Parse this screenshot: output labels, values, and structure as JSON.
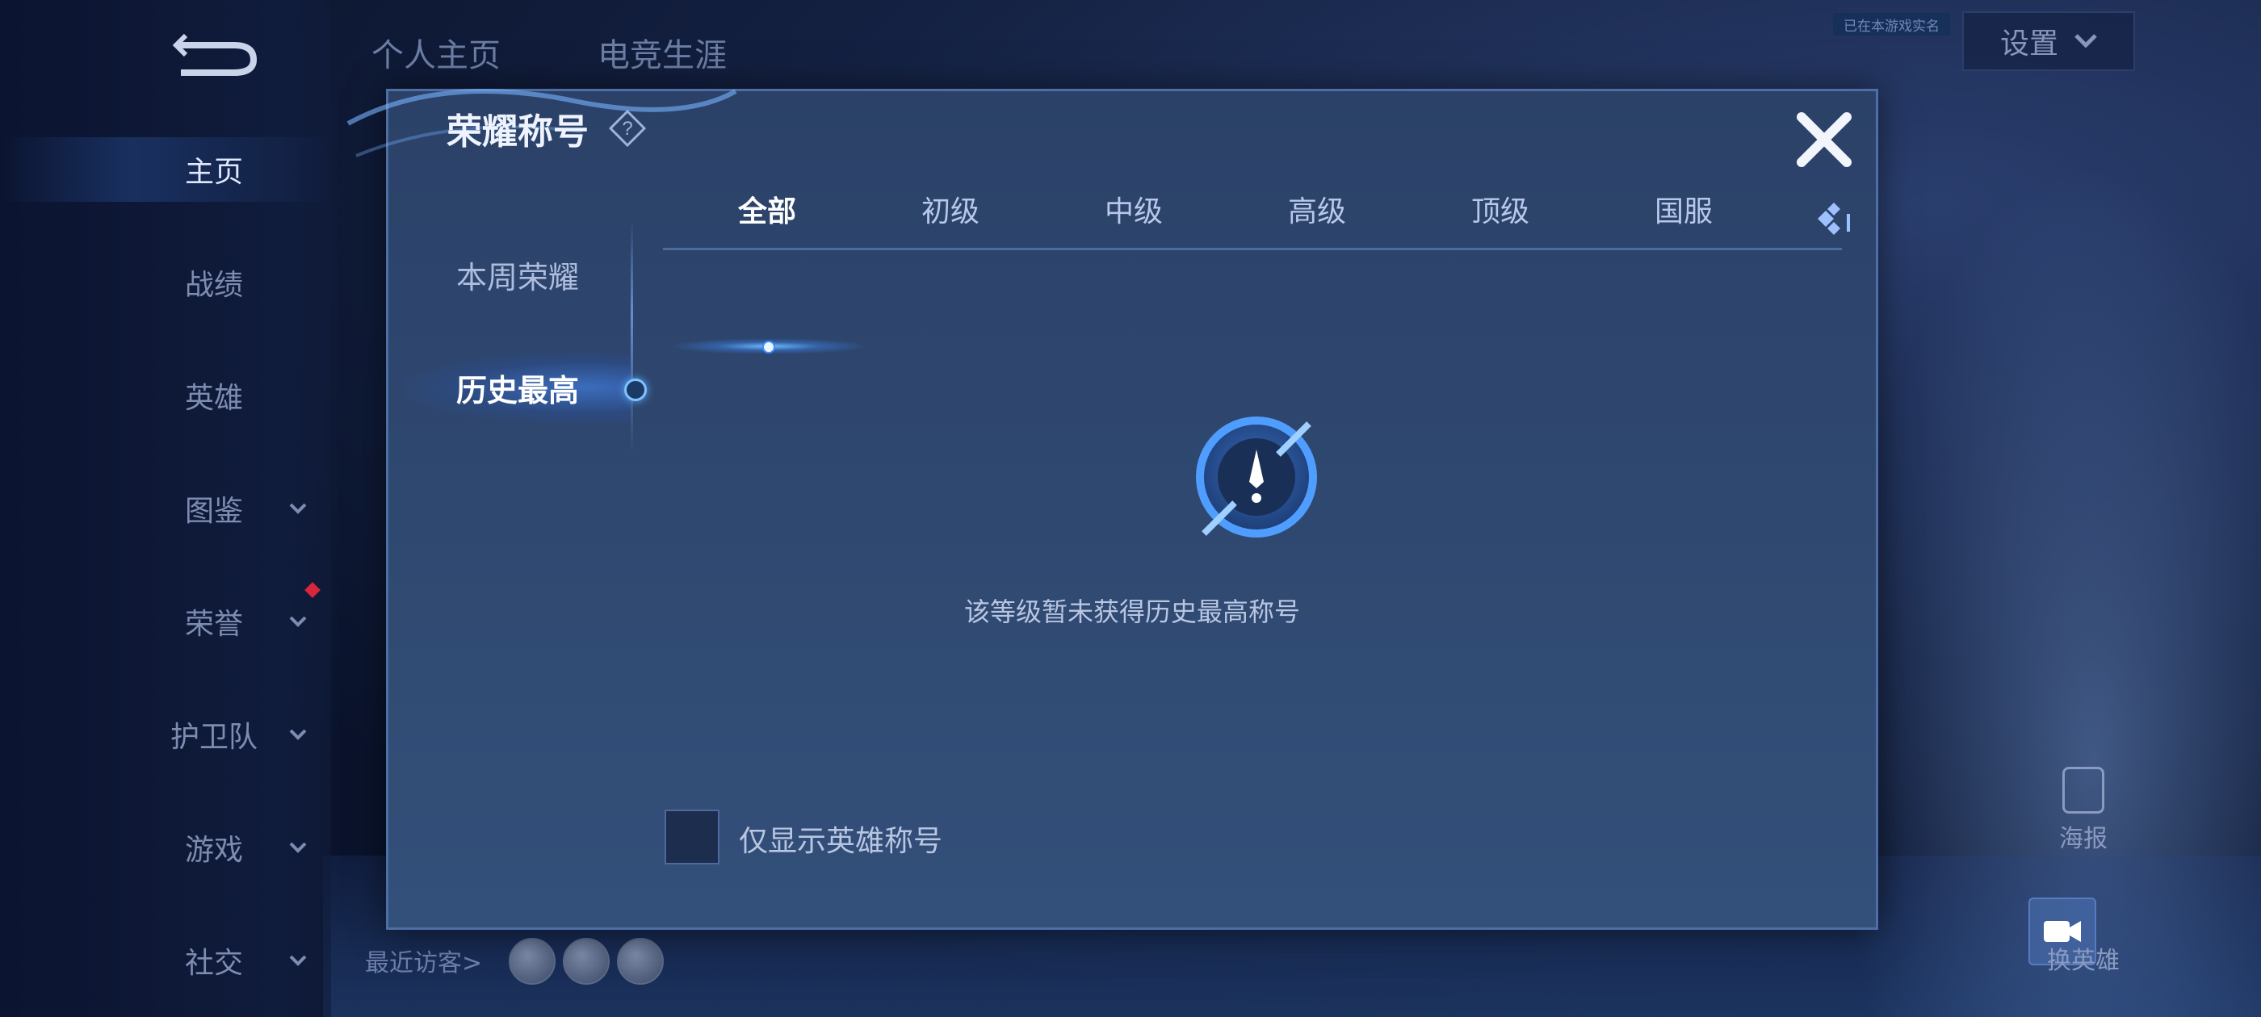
{
  "top_tabs": [
    "个人主页",
    "电竞生涯"
  ],
  "settings": {
    "label": "设置"
  },
  "badge": {
    "text": "已在本游戏实名"
  },
  "nav": {
    "items": [
      {
        "label": "主页",
        "active": true,
        "has_chevron": false
      },
      {
        "label": "战绩",
        "active": false,
        "has_chevron": false
      },
      {
        "label": "英雄",
        "active": false,
        "has_chevron": false
      },
      {
        "label": "图鉴",
        "active": false,
        "has_chevron": true
      },
      {
        "label": "荣誉",
        "active": false,
        "has_chevron": true,
        "notification": true
      },
      {
        "label": "护卫队",
        "active": false,
        "has_chevron": true
      },
      {
        "label": "游戏",
        "active": false,
        "has_chevron": true
      },
      {
        "label": "社交",
        "active": false,
        "has_chevron": true
      }
    ]
  },
  "visitors": {
    "label": "最近访客>"
  },
  "right": {
    "poster_label": "海报",
    "switch_hero_label": "换英雄"
  },
  "modal": {
    "title": "荣耀称号",
    "side_tabs": [
      "本周荣耀",
      "历史最高"
    ],
    "active_side_tab": "历史最高",
    "level_tabs": [
      "全部",
      "初级",
      "中级",
      "高级",
      "顶级",
      "国服"
    ],
    "active_level_tab": "全部",
    "empty_message": "该等级暂未获得历史最高称号",
    "filter_checkbox": {
      "label": "仅显示英雄称号",
      "checked": false
    }
  },
  "colors": {
    "accent": "#4f9dff",
    "modal_bg": "#2f4870",
    "notification": "#d8263b"
  }
}
